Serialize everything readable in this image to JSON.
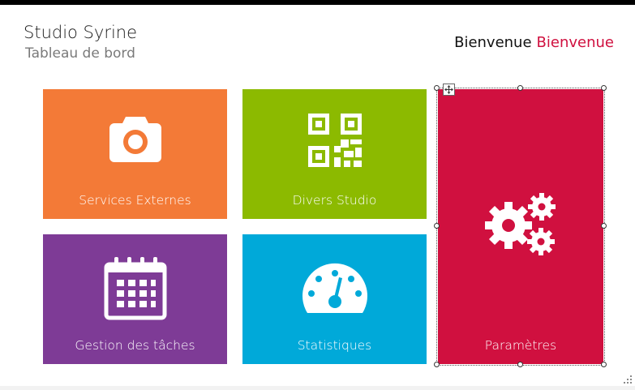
{
  "header": {
    "title": "Studio Syrine",
    "subtitle": "Tableau de bord",
    "welcome_label": "Bienvenue",
    "welcome_user": "Bienvenue"
  },
  "tiles": [
    {
      "label": "Services Externes",
      "icon": "camera-icon",
      "color": "#f37a37"
    },
    {
      "label": "Divers Studio",
      "icon": "qr-code-icon",
      "color": "#8cba00"
    },
    {
      "label": "Paramètres",
      "icon": "gears-icon",
      "color": "#d0103f"
    },
    {
      "label": "Gestion des tâches",
      "icon": "calendar-icon",
      "color": "#7e3b96"
    },
    {
      "label": "Statistiques",
      "icon": "gauge-icon",
      "color": "#00a9d9"
    }
  ],
  "selection": {
    "selected_tile": "Paramètres"
  },
  "colors": {
    "accent": "#d0103f",
    "title_bar": "#000000"
  }
}
